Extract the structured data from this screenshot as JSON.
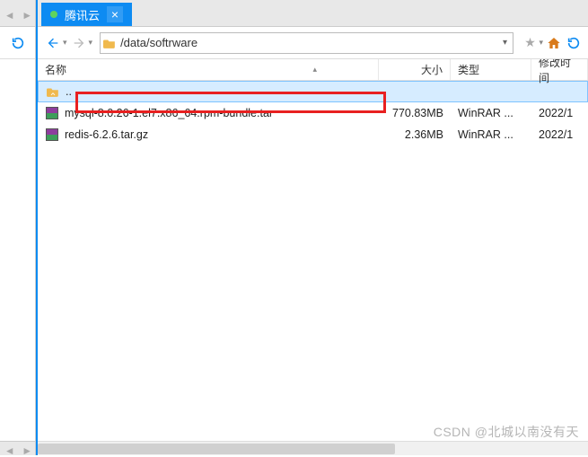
{
  "tab": {
    "title": "腾讯云",
    "close": "×"
  },
  "address": {
    "path": "/data/softrware"
  },
  "columns": {
    "name": "名称",
    "size": "大小",
    "type": "类型",
    "date": "修改时间"
  },
  "rows": [
    {
      "name": "..",
      "size": "",
      "type": "",
      "date": "",
      "icon": "folder-up"
    },
    {
      "name": "mysql-8.0.26-1.el7.x86_64.rpm-bundle.tar",
      "size": "770.83MB",
      "type": "WinRAR ...",
      "date": "2022/1",
      "icon": "rar"
    },
    {
      "name": "redis-6.2.6.tar.gz",
      "size": "2.36MB",
      "type": "WinRAR ...",
      "date": "2022/1",
      "icon": "rar"
    }
  ],
  "watermark": "CSDN @北城以南没有天"
}
